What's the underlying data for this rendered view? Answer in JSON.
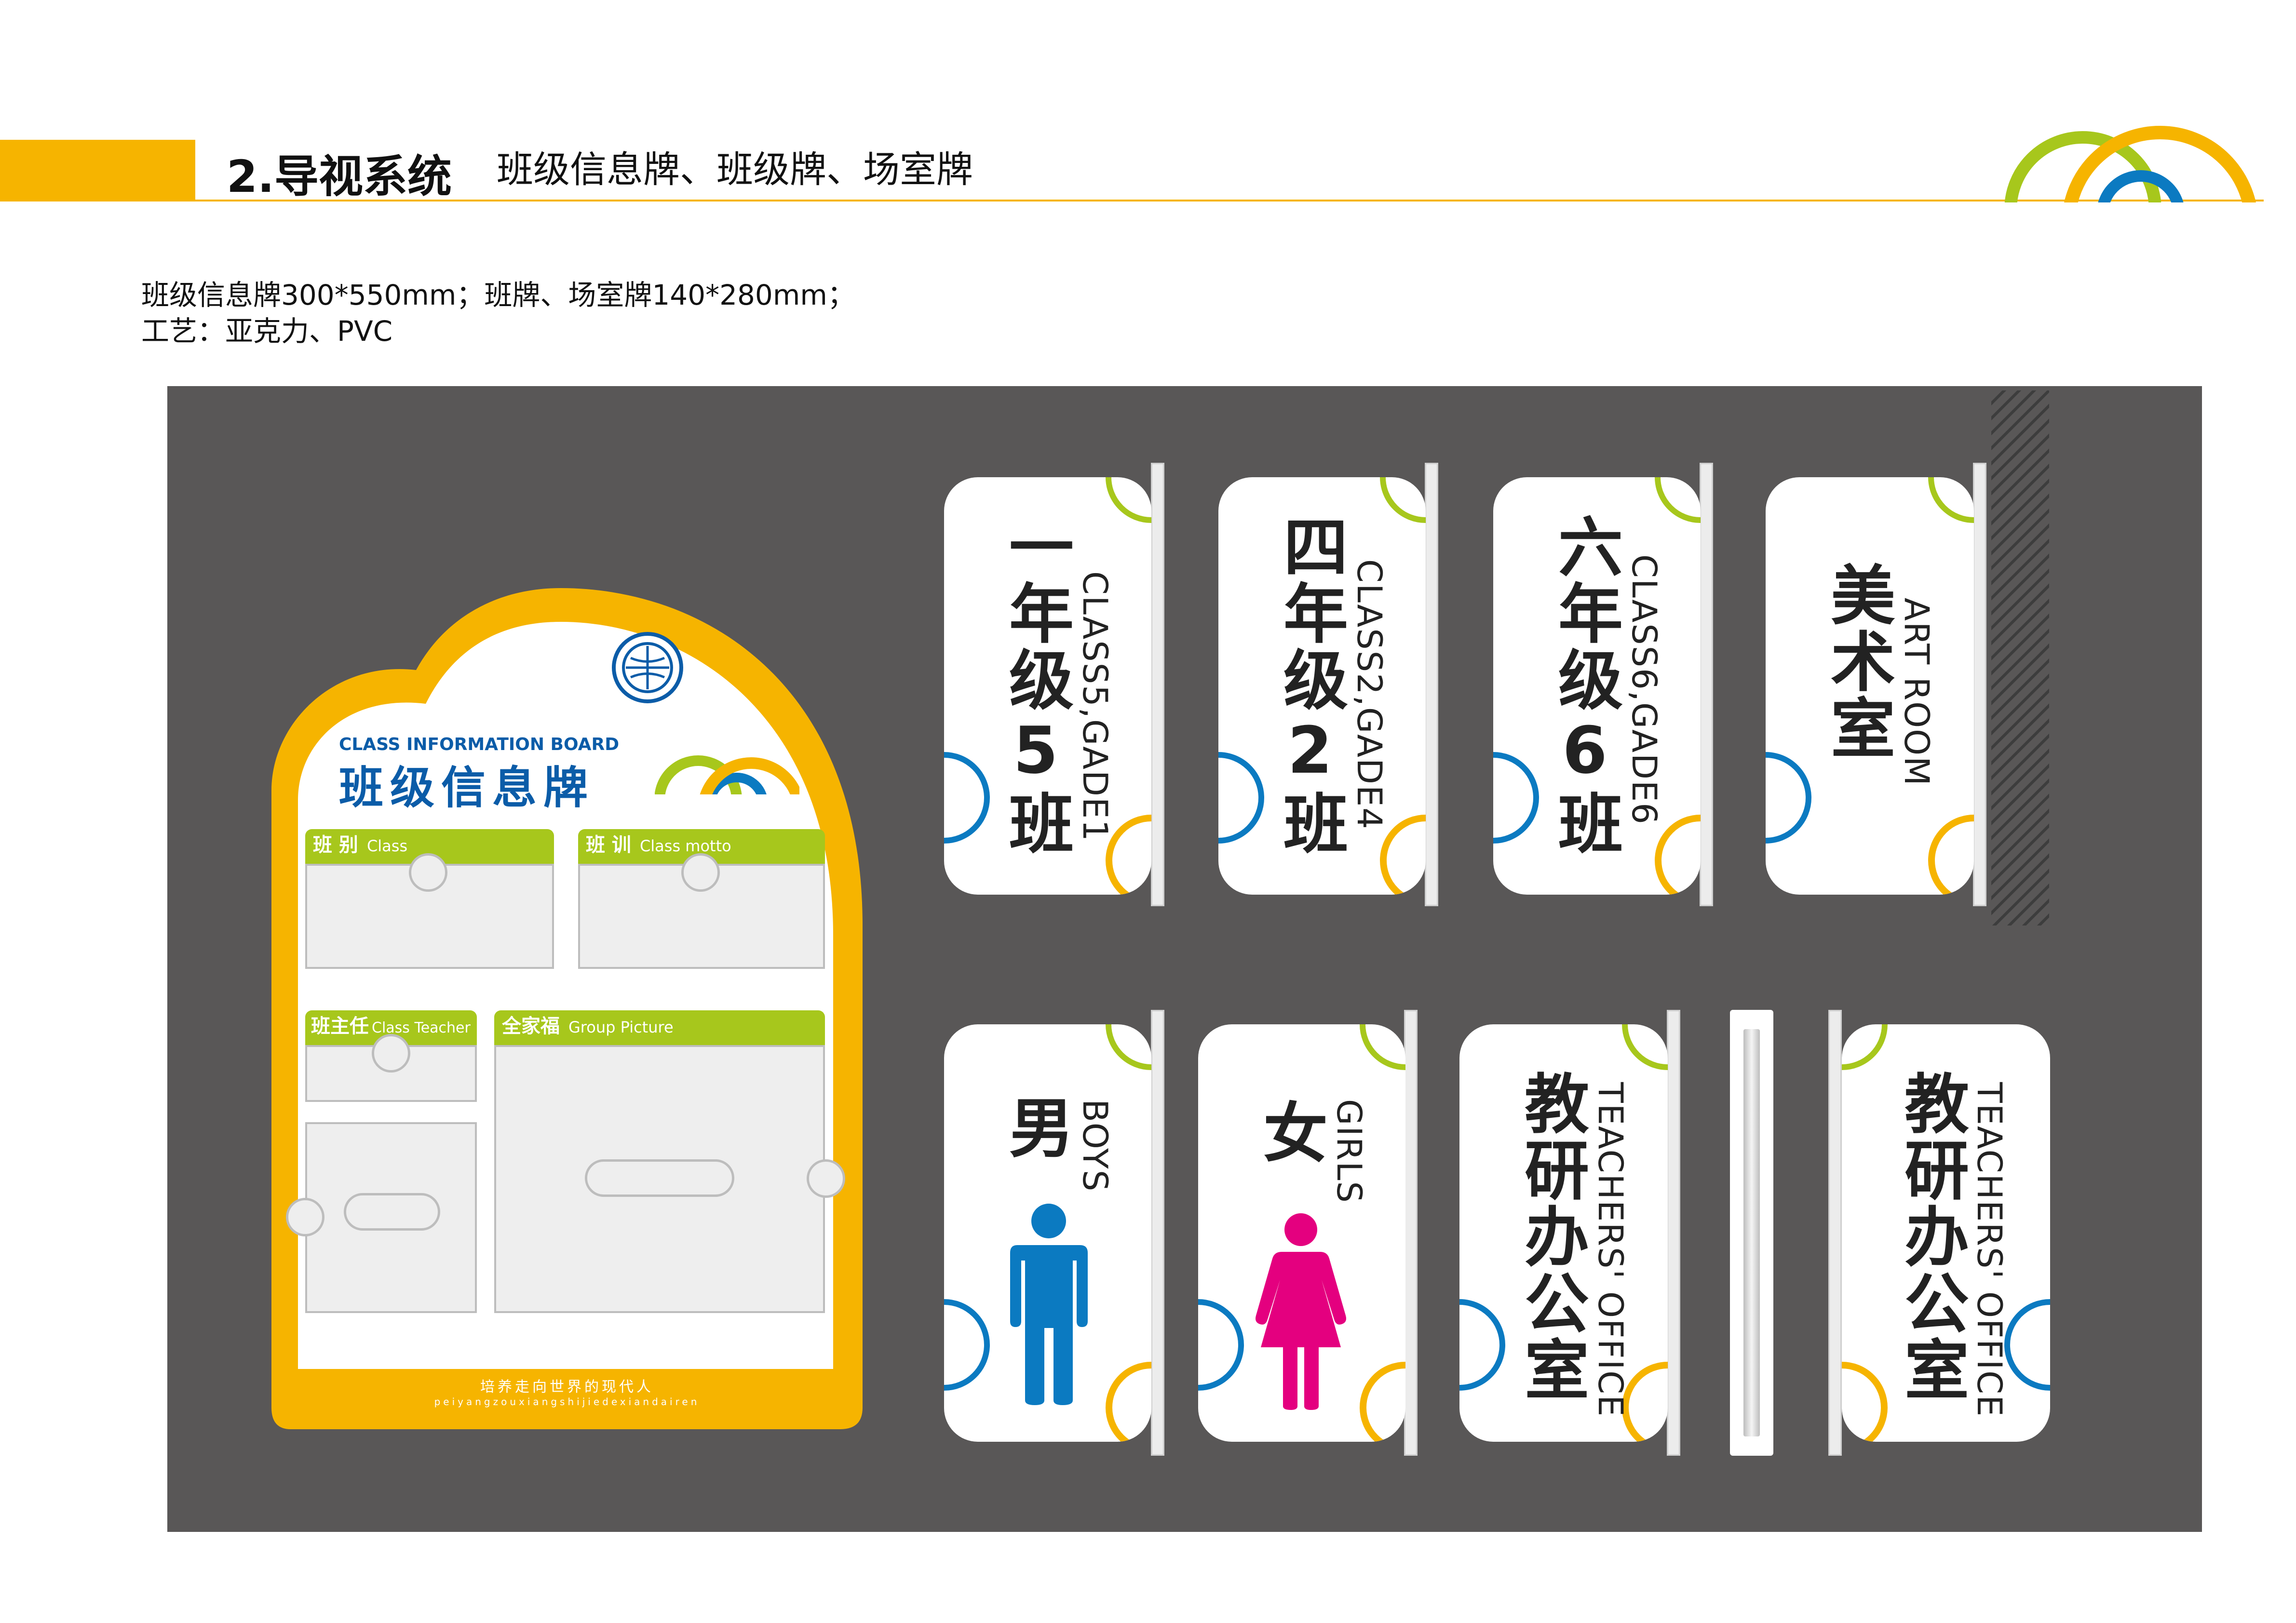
{
  "header": {
    "title": "2.导视系统",
    "subtitle": "班级信息牌、班级牌、场室牌"
  },
  "spec": {
    "line1": "班级信息牌300*550mm；班牌、场室牌140*280mm；",
    "line2": "工艺：亚克力、PVC"
  },
  "colors": {
    "brand_yellow": "#F6B400",
    "brand_green": "#A7C71C",
    "brand_blue": "#0B7AC1",
    "panel_gray": "#595757",
    "female_pink": "#E4007F"
  },
  "board": {
    "en_title": "CLASS INFORMATION BOARD",
    "cn_title": "班级信息牌",
    "sections": {
      "class": {
        "cn": "班 别",
        "en": "Class"
      },
      "motto": {
        "cn": "班 训",
        "en": "Class motto"
      },
      "teacher": {
        "cn": "班主任",
        "en": "Class Teacher"
      },
      "group": {
        "cn": "全家福",
        "en": "Group Picture"
      }
    },
    "footer_cn": "培养走向世界的现代人",
    "footer_pinyin": "peiyangzouxiangshijiedexiandairen"
  },
  "signs": {
    "class5": {
      "cn": "一年级5班",
      "en": "CLASS5,GADE1"
    },
    "class2": {
      "cn": "四年级2班",
      "en": "CLASS2,GADE4"
    },
    "class6": {
      "cn": "六年级6班",
      "en": "CLASS6,GADE6"
    },
    "art": {
      "cn": "美术室",
      "en": "ART ROOM"
    },
    "boys": {
      "cn": "男",
      "en": "BOYS"
    },
    "girls": {
      "cn": "女",
      "en": "GIRLS"
    },
    "office_a": {
      "cn": "教研办公室",
      "en": "TEACHERS' OFFICE"
    },
    "office_b": {
      "cn": "教研办公室",
      "en": "TEACHERS' OFFICE"
    }
  },
  "icons": [
    "logo-rings-icon",
    "school-emblem-icon",
    "man-icon",
    "woman-icon"
  ]
}
